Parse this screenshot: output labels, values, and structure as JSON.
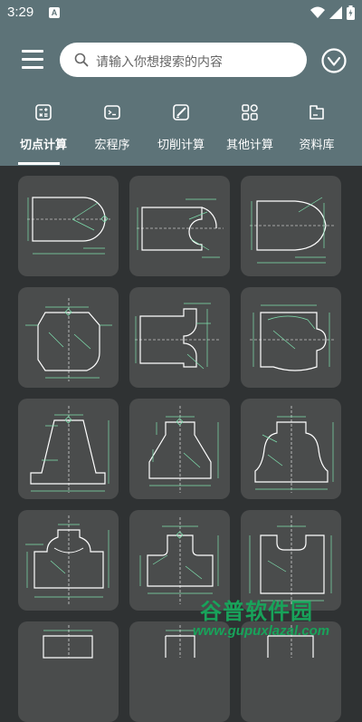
{
  "status_bar": {
    "time": "3:29",
    "notification_icon": "A"
  },
  "search": {
    "placeholder": "请输入你想搜索的内容"
  },
  "tabs": [
    {
      "label": "切点计算",
      "icon": "calculator-icon",
      "active": true
    },
    {
      "label": "宏程序",
      "icon": "terminal-icon",
      "active": false
    },
    {
      "label": "切削计算",
      "icon": "edit-icon",
      "active": false
    },
    {
      "label": "其他计算",
      "icon": "grid-icon",
      "active": false
    },
    {
      "label": "资料库",
      "icon": "folder-icon",
      "active": false
    }
  ],
  "cards": [
    {
      "diagram": "rounded-end-profile-diagram"
    },
    {
      "diagram": "concave-end-profile-diagram"
    },
    {
      "diagram": "pointed-arc-profile-diagram"
    },
    {
      "diagram": "chamfer-radius-profile-diagram"
    },
    {
      "diagram": "step-arc-profile-diagram"
    },
    {
      "diagram": "arc-shoulder-profile-diagram"
    },
    {
      "diagram": "taper-base-profile-diagram"
    },
    {
      "diagram": "taper-radius-profile-diagram"
    },
    {
      "diagram": "double-arc-profile-diagram"
    },
    {
      "diagram": "neck-arc-profile-diagram"
    },
    {
      "diagram": "neck-step-profile-diagram"
    },
    {
      "diagram": "neck-shoulder-profile-diagram"
    },
    {
      "diagram": "partial-profile-diagram"
    },
    {
      "diagram": "partial-profile-diagram"
    },
    {
      "diagram": "partial-profile-diagram"
    }
  ],
  "watermark": {
    "line1": "谷普软件园",
    "line2": "www.gupuxlazal.com"
  },
  "colors": {
    "header": "#5d7378",
    "background": "#2f3233",
    "card": "#4a4c4c",
    "line": "#ffffff",
    "dimension": "#7fe0ae",
    "watermark": "#18a35a"
  }
}
